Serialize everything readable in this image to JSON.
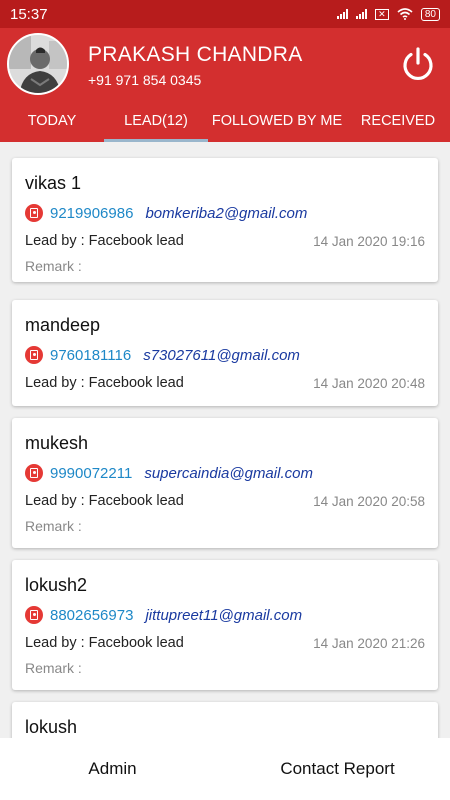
{
  "status_bar": {
    "time": "15:37",
    "battery": "80"
  },
  "profile": {
    "name": "PRAKASH CHANDRA",
    "phone": "+91 971 854 0345"
  },
  "tabs": [
    {
      "label": "TODAY"
    },
    {
      "label": "LEAD(12)",
      "active": true
    },
    {
      "label": "FOLLOWED BY ME"
    },
    {
      "label": "RECEIVED"
    }
  ],
  "leads": [
    {
      "name": "vikas 1",
      "phone": "9219906986",
      "email": "bomkeriba2@gmail.com",
      "lead_by": "Lead by : Facebook lead",
      "date": "14 Jan 2020 19:16",
      "remark": "Remark :"
    },
    {
      "name": "mandeep",
      "phone": "9760181116",
      "email": "s73027611@gmail.com",
      "lead_by": "Lead by : Facebook lead",
      "date": "14 Jan 2020 20:48",
      "remark": ""
    },
    {
      "name": "mukesh",
      "phone": "9990072211",
      "email": "supercaindia@gmail.com",
      "lead_by": "Lead by : Facebook lead",
      "date": "14 Jan 2020 20:58",
      "remark": "Remark :"
    },
    {
      "name": "lokush2",
      "phone": "8802656973",
      "email": "jittupreet11@gmail.com",
      "lead_by": "Lead by : Facebook lead",
      "date": "14 Jan 2020 21:26",
      "remark": "Remark :"
    },
    {
      "name": "lokush"
    }
  ],
  "bottom_nav": {
    "admin": "Admin",
    "contact_report": "Contact Report"
  },
  "colors": {
    "primary": "#d32f2f",
    "status_bar": "#b71c1c",
    "tab_indicator": "#9ab6cc",
    "phone_text": "#1e88c7",
    "email_text": "#1a3aa0"
  }
}
